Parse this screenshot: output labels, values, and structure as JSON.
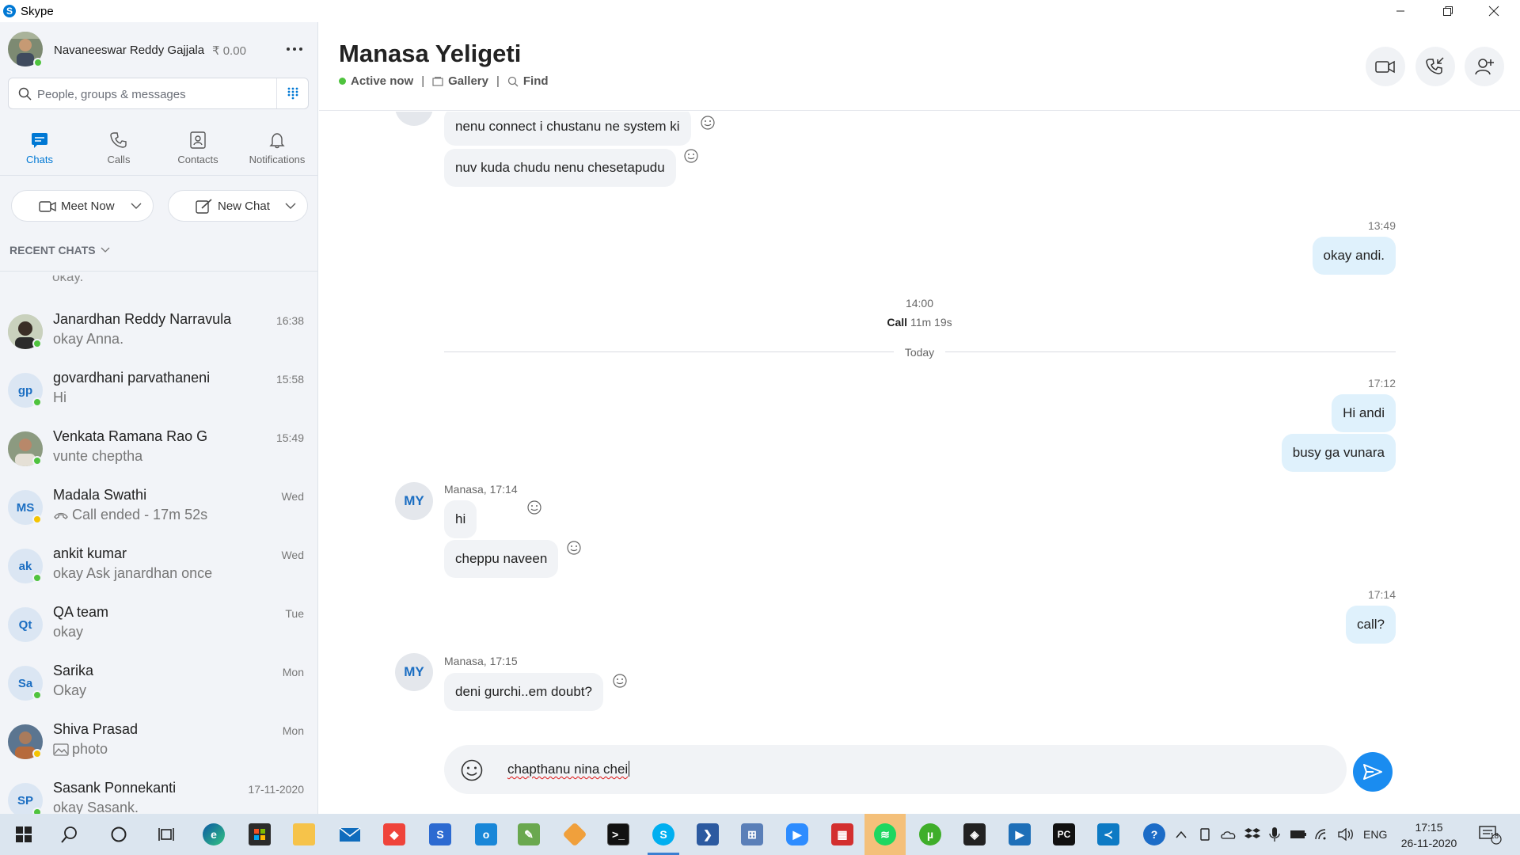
{
  "window": {
    "title": "Skype",
    "app_icon_letter": "S"
  },
  "profile": {
    "name": "Navaneeswar Reddy Gajjala",
    "credit": "₹ 0.00"
  },
  "search": {
    "placeholder": "People, groups & messages"
  },
  "nav_tabs": [
    {
      "label": "Chats",
      "icon": "chat-icon",
      "active": true
    },
    {
      "label": "Calls",
      "icon": "phone-icon",
      "active": false
    },
    {
      "label": "Contacts",
      "icon": "contacts-icon",
      "active": false
    },
    {
      "label": "Notifications",
      "icon": "bell-icon",
      "active": false
    }
  ],
  "actions": {
    "meet_now": "Meet Now",
    "new_chat": "New Chat"
  },
  "recent_header": "RECENT CHATS",
  "recent_partial_snippet": "okay.",
  "chats": [
    {
      "name": "Janardhan Reddy Narravula",
      "snippet": "okay Anna.",
      "time": "16:38",
      "avatar": "photo",
      "status": "online"
    },
    {
      "name": "govardhani parvathaneni",
      "snippet": "Hi",
      "time": "15:58",
      "initials": "gp",
      "status": "online"
    },
    {
      "name": "Venkata Ramana Rao G",
      "snippet": "vunte cheptha",
      "time": "15:49",
      "avatar": "photo",
      "status": "online"
    },
    {
      "name": "Madala Swathi",
      "snippet": "Call ended - 17m 52s",
      "time": "Wed",
      "initials": "MS",
      "status": "away",
      "snippet_icon": "call-ended-icon"
    },
    {
      "name": "ankit kumar",
      "snippet": "okay Ask janardhan once",
      "time": "Wed",
      "initials": "ak",
      "status": "online"
    },
    {
      "name": "QA team",
      "snippet": "okay",
      "time": "Tue",
      "initials": "Qt",
      "status": "none"
    },
    {
      "name": "Sarika",
      "snippet": "Okay",
      "time": "Mon",
      "initials": "Sa",
      "status": "online"
    },
    {
      "name": "Shiva Prasad",
      "snippet": "photo",
      "time": "Mon",
      "avatar": "photo",
      "status": "away",
      "snippet_icon": "image-icon"
    },
    {
      "name": "Sasank Ponnekanti",
      "snippet": "okay Sasank.",
      "time": "17-11-2020",
      "initials": "SP",
      "status": "online"
    }
  ],
  "conversation": {
    "title": "Manasa Yeligeti",
    "status": "Active now",
    "gallery": "Gallery",
    "find": "Find",
    "contact_initials": "MY",
    "messages_top": [
      {
        "text": "nenu connect i chustanu ne system ki"
      },
      {
        "text": "nuv kuda chudu nenu chesetapudu"
      }
    ],
    "out_1": {
      "time": "13:49",
      "texts": [
        "okay andi."
      ]
    },
    "call": {
      "time": "14:00",
      "label": "Call",
      "duration": "11m 19s"
    },
    "day_separator": "Today",
    "out_2": {
      "time": "17:12",
      "texts": [
        "Hi andi",
        "busy ga vunara"
      ]
    },
    "in_1": {
      "sender": "Manasa, 17:14",
      "texts": [
        "hi",
        "cheppu naveen"
      ]
    },
    "out_3": {
      "time": "17:14",
      "texts": [
        "call?"
      ]
    },
    "in_2": {
      "sender": "Manasa, 17:15",
      "texts": [
        "deni gurchi..em doubt?"
      ]
    },
    "read_receipt": "MY",
    "draft": "chapthanu nina chei"
  },
  "taskbar": {
    "language": "ENG",
    "time": "17:15",
    "date": "26-11-2020",
    "notification_count": "18",
    "pinned_icons": [
      "windows-start-icon",
      "search-icon",
      "cortana-icon",
      "task-view-icon",
      "edge-icon",
      "store-icon",
      "file-explorer-icon",
      "mail-icon",
      "anydesk-icon",
      "visual-studio-icon",
      "skype-business-icon",
      "paint-icon",
      "git-icon",
      "terminal-icon",
      "skype-icon",
      "powershell-icon",
      "network-icon",
      "zoom-icon",
      "calendar-icon",
      "spotify-icon",
      "utorrent-icon",
      "unity-icon",
      "player-icon",
      "pycharm-icon",
      "vscode-icon"
    ]
  },
  "colors": {
    "accent": "#0078d4",
    "online": "#4fc33e",
    "away": "#f5c400",
    "bubble_out": "#dff1fc",
    "bubble_in": "#f1f3f6"
  }
}
